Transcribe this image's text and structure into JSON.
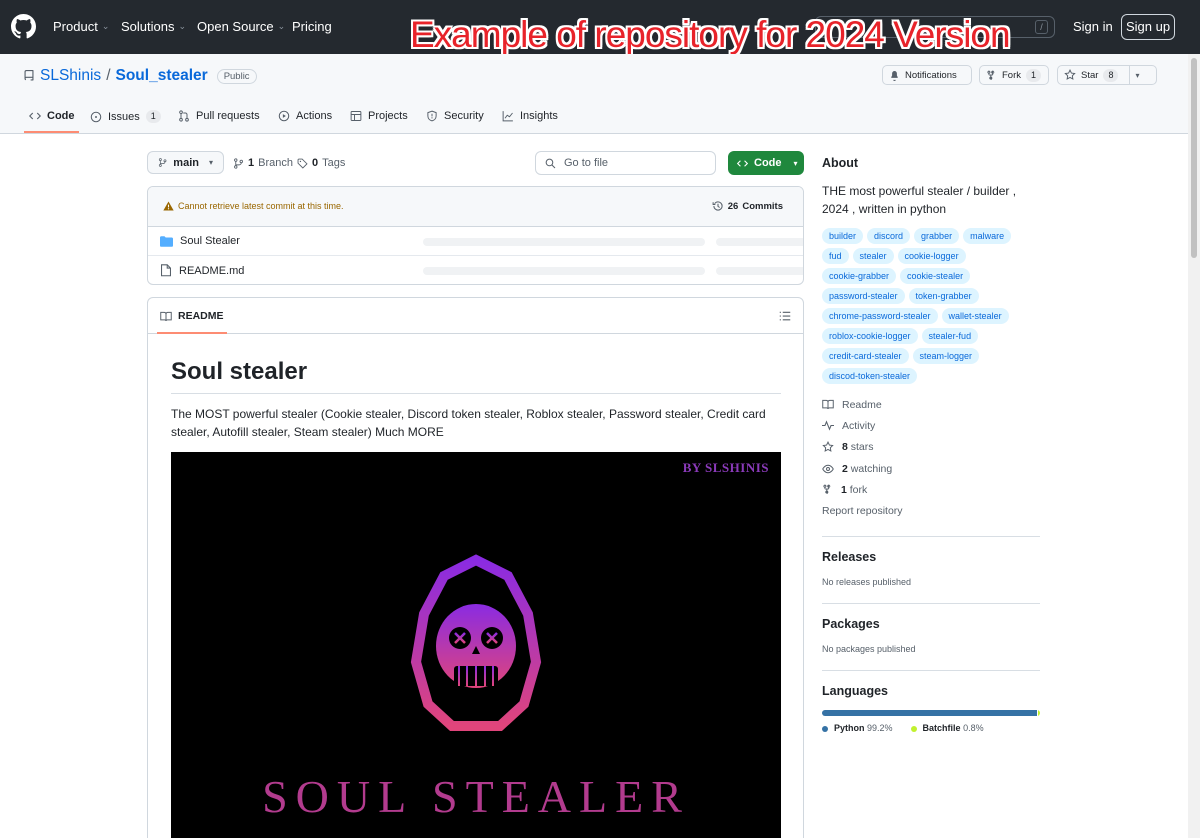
{
  "banner": "Example of repository for 2024 Version",
  "topnav": {
    "items": [
      {
        "label": "Product",
        "dropdown": true
      },
      {
        "label": "Solutions",
        "dropdown": true
      },
      {
        "label": "Open Source",
        "dropdown": true
      },
      {
        "label": "Pricing",
        "dropdown": false
      }
    ],
    "search_shortcut": "/",
    "signin": "Sign in",
    "signup": "Sign up"
  },
  "repo": {
    "owner": "SLShinis",
    "separator": "/",
    "name": "Soul_stealer",
    "visibility": "Public",
    "notifications_label": "Notifications",
    "fork_label": "Fork",
    "fork_count": "1",
    "star_label": "Star",
    "star_count": "8"
  },
  "tabs": [
    {
      "label": "Code",
      "count": "",
      "icon": "code-icon"
    },
    {
      "label": "Issues",
      "count": "1",
      "icon": "issue-icon"
    },
    {
      "label": "Pull requests",
      "count": "",
      "icon": "pull-request-icon"
    },
    {
      "label": "Actions",
      "count": "",
      "icon": "play-icon"
    },
    {
      "label": "Projects",
      "count": "",
      "icon": "table-icon"
    },
    {
      "label": "Security",
      "count": "",
      "icon": "shield-icon"
    },
    {
      "label": "Insights",
      "count": "",
      "icon": "graph-icon"
    }
  ],
  "toolbar": {
    "branch": "main",
    "branch_count": "1",
    "branch_label": "Branch",
    "tag_count": "0",
    "tag_label": "Tags",
    "goto_placeholder": "Go to file",
    "code_button": "Code"
  },
  "files": {
    "warning": "Cannot retrieve latest commit at this time.",
    "commits_count": "26",
    "commits_label": "Commits",
    "rows": [
      {
        "name": "Soul Stealer",
        "type": "folder"
      },
      {
        "name": "README.md",
        "type": "file"
      }
    ]
  },
  "readme": {
    "tab_label": "README",
    "title": "Soul stealer",
    "description": "The MOST powerful stealer (Cookie stealer, Discord token stealer, Roblox stealer, Password stealer, Credit card stealer, Autofill stealer, Steam stealer) Much MORE",
    "image": {
      "by_text": "BY SLSHINIS",
      "logo_text": "SOUL STEALER"
    }
  },
  "about": {
    "heading": "About",
    "description": "THE most powerful stealer / builder , 2024 , written in python",
    "topics": [
      "builder",
      "discord",
      "grabber",
      "malware",
      "fud",
      "stealer",
      "cookie-logger",
      "cookie-grabber",
      "cookie-stealer",
      "password-stealer",
      "token-grabber",
      "chrome-password-stealer",
      "wallet-stealer",
      "roblox-cookie-logger",
      "stealer-fud",
      "credit-card-stealer",
      "steam-logger",
      "discod-token-stealer"
    ],
    "readme": "Readme",
    "activity": "Activity",
    "stars_count": "8",
    "stars_label": "stars",
    "watching_count": "2",
    "watching_label": "watching",
    "fork_count": "1",
    "fork_label": "fork",
    "report": "Report repository"
  },
  "releases": {
    "heading": "Releases",
    "note": "No releases published"
  },
  "packages": {
    "heading": "Packages",
    "note": "No packages published"
  },
  "languages": {
    "heading": "Languages",
    "items": [
      {
        "name": "Python",
        "percent": "99.2%",
        "value": 99.2,
        "color": "#3572A5"
      },
      {
        "name": "Batchfile",
        "percent": "0.8%",
        "value": 0.8,
        "color": "#C1F12E"
      }
    ]
  }
}
